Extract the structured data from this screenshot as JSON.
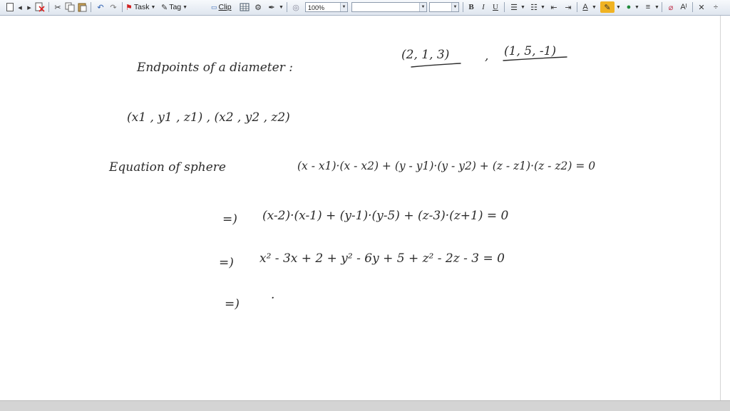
{
  "toolbar": {
    "task_label": "Task",
    "tag_label": "Tag",
    "clip_label": "Clip",
    "zoom_value": "100%",
    "font_name": "",
    "font_size": "",
    "bold": "B",
    "italic": "I",
    "underline": "U",
    "text_color": "A",
    "accent_color": "#f0b323"
  },
  "notes": {
    "line1_label": "Endpoints of a diameter :",
    "point_a": "(2, 1, 3)",
    "point_sep": ",",
    "point_b": "(1, 5, -1)",
    "line2": "(x1 , y1 , z1)  , (x2 , y2 , z2)",
    "line3_label": "Equation of sphere",
    "line3_eq": "(x - x1)·(x - x2) + (y - y1)·(y - y2) + (z - z1)·(z - z2) = 0",
    "line4_arrow": "=)",
    "line4_eq": "(x-2)·(x-1) + (y-1)·(y-5) + (z-3)·(z+1) = 0",
    "line5_arrow": "=)",
    "line5_eq": "x² - 3x + 2   + y² - 6y + 5  + z² - 2z - 3 = 0",
    "line6_arrow": "=)",
    "line6_eq": "·"
  }
}
